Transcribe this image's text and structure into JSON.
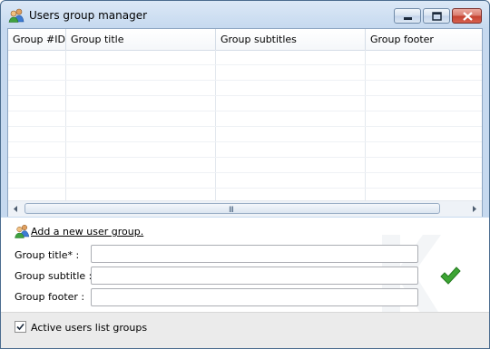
{
  "window": {
    "title": "Users group manager"
  },
  "grid": {
    "columns": [
      "Group #ID",
      "Group title",
      "Group subtitles",
      "Group footer"
    ],
    "rows": []
  },
  "form": {
    "add_link": "Add a new user group.",
    "title_label": "Group title* :",
    "subtitle_label": "Group subtitle :",
    "footer_label": "Group footer :",
    "title_value": "",
    "subtitle_value": "",
    "footer_value": ""
  },
  "footer": {
    "active_label": "Active users list groups",
    "active_checked": true
  },
  "scroll": {
    "grip": "III"
  },
  "colors": {
    "accent": "#3da534",
    "window_frame": "#4c6d8f"
  },
  "icons": [
    "users-icon",
    "minimize-icon",
    "maximize-icon",
    "close-icon",
    "scroll-left-icon",
    "scroll-right-icon",
    "add-users-icon",
    "checkmark-icon",
    "checkbox-checked-icon"
  ]
}
